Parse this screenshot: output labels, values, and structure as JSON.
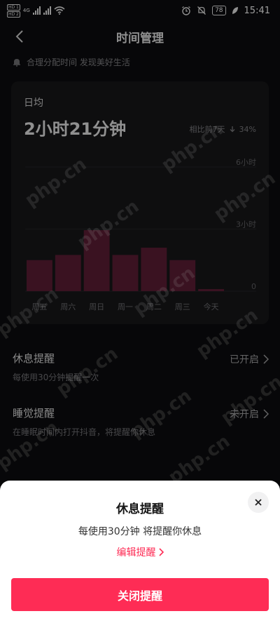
{
  "status_bar": {
    "hd1": "HD 1",
    "hd2": "HD 2",
    "net": "4G",
    "battery": "78",
    "time": "15:41"
  },
  "nav": {
    "title": "时间管理"
  },
  "tip": {
    "text": "合理分配时间 发现美好生活"
  },
  "card": {
    "label": "日均",
    "daily_avg": "2小时21分钟",
    "compare_label": "相比前7天",
    "compare_value": "34%"
  },
  "chart_data": {
    "type": "bar",
    "categories": [
      "周五",
      "周六",
      "周日",
      "周一",
      "周二",
      "周三",
      "今天"
    ],
    "values": [
      1.5,
      1.75,
      2.95,
      1.75,
      2.1,
      1.5,
      0.1
    ],
    "ylim": [
      0,
      6
    ],
    "y_ticks": [
      {
        "value": 0,
        "label": "0"
      },
      {
        "value": 3,
        "label": "3小时"
      },
      {
        "value": 6,
        "label": "6小时"
      }
    ],
    "bar_color": "#5a1d33"
  },
  "settings": [
    {
      "title": "休息提醒",
      "subtitle": "每使用30分钟提醒一次",
      "status": "已开启"
    },
    {
      "title": "睡觉提醒",
      "subtitle": "在睡眠时间内打开抖音，将提醒你休息",
      "status": "未开启"
    }
  ],
  "watermark": {
    "text": "php.cn"
  },
  "sheet": {
    "title": "休息提醒",
    "description": "每使用30分钟 将提醒你休息",
    "edit_label": "编辑提醒",
    "close_button_label": "关闭提醒",
    "accent": "#fe2c55"
  }
}
